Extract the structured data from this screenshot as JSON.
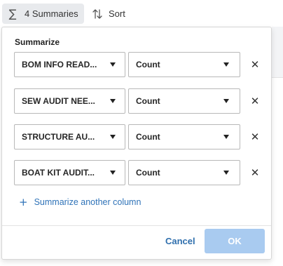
{
  "toolbar": {
    "summaries_label": "4 Summaries",
    "sort_label": "Sort",
    "summaries_icon": "sigma-icon",
    "sort_icon": "sort-arrows-icon"
  },
  "popup": {
    "title": "Summarize",
    "rows": [
      {
        "column": "BOM INFO READ...",
        "aggregation": "Count"
      },
      {
        "column": "SEW AUDIT NEE...",
        "aggregation": "Count"
      },
      {
        "column": "STRUCTURE AU...",
        "aggregation": "Count"
      },
      {
        "column": "BOAT KIT AUDIT...",
        "aggregation": "Count"
      }
    ],
    "add_label": "Summarize another column",
    "cancel_label": "Cancel",
    "ok_label": "OK"
  },
  "colors": {
    "accent": "#2f73b8",
    "ok_disabled": "#a9cbf0",
    "toolbar_active": "#e8eaed"
  }
}
